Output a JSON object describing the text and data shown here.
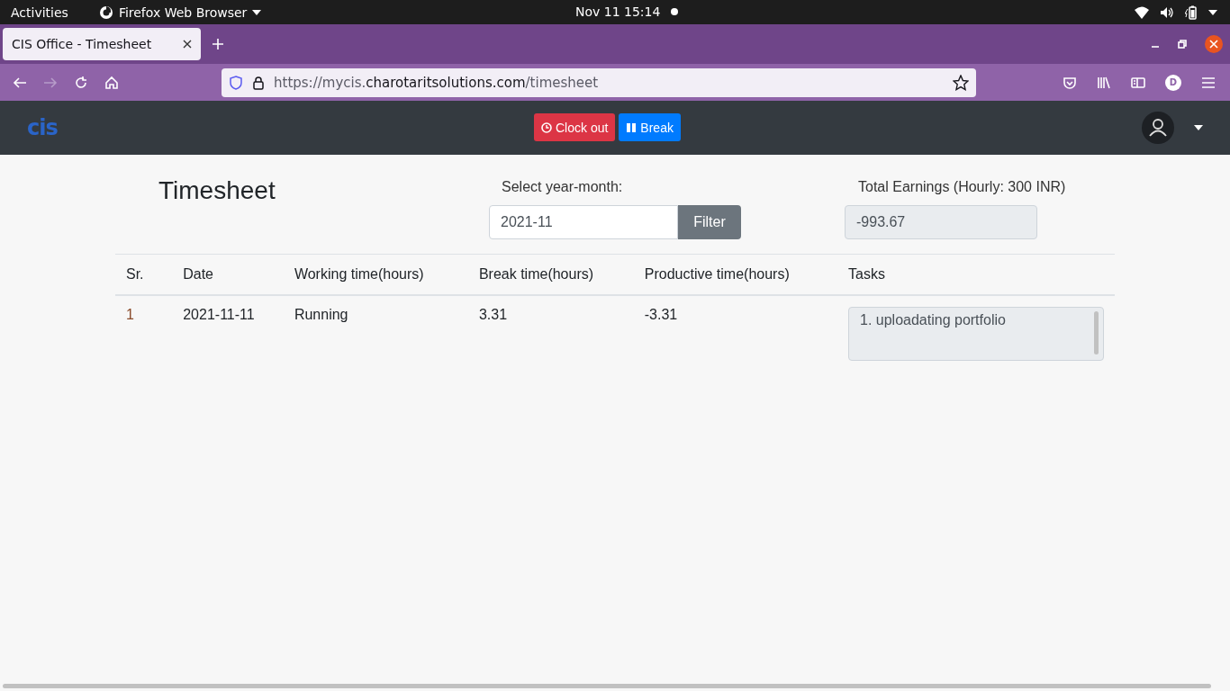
{
  "os_bar": {
    "activities": "Activities",
    "app_menu": "Firefox Web Browser",
    "clock": "Nov 11  15:14"
  },
  "browser": {
    "tabs": [
      {
        "label": "CIS Office - Timesheet",
        "selected": true
      }
    ],
    "url": {
      "scheme": "https://mycis.",
      "domain": "charotaritsolutions.com",
      "path": "/timesheet"
    },
    "account_initial": "D"
  },
  "navbar": {
    "logo": "cis",
    "buttons": [
      {
        "kind": "danger",
        "label": "Clock out"
      },
      {
        "kind": "primary",
        "label": "Break"
      }
    ]
  },
  "page": {
    "title": "Timesheet",
    "filter_label": "Select year-month:",
    "month_field": {
      "value": "2021-11"
    },
    "filter_button": "Filter",
    "earnings_label": "Total Earnings (Hourly: 300 INR)",
    "earnings_field": {
      "value": "-993.67"
    },
    "table": {
      "columns": [
        "Sr.",
        "Date",
        "Working time(hours)",
        "Break time(hours)",
        "Productive time(hours)",
        "Tasks"
      ],
      "rows": [
        {
          "sr": "1",
          "date": "2021-11-11",
          "working": "Running",
          "break": "3.31",
          "productive": "-3.31",
          "tasks": "1. uploadating portfolio"
        }
      ]
    }
  }
}
